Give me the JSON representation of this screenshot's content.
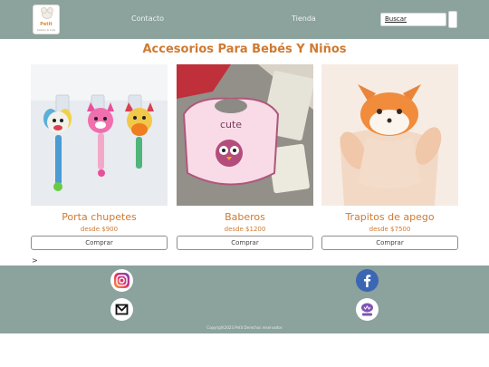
{
  "header": {
    "logo_text": "Petit",
    "logo_subtext": "babies & kids",
    "nav": [
      {
        "label": "Contacto"
      },
      {
        "label": "Tienda"
      }
    ],
    "search": {
      "value": "Buscar"
    }
  },
  "main": {
    "title": "Accesorios Para Bebés Y Niños",
    "products": [
      {
        "name": "Porta chupetes",
        "price": "desde $900",
        "button": "Comprar",
        "image": "plush-pacifier-holders"
      },
      {
        "name": "Baberos",
        "price": "desde $1200",
        "button": "Comprar",
        "image": "owl-bibs"
      },
      {
        "name": "Trapitos de apego",
        "price": "desde $7500",
        "button": "Comprar",
        "image": "fox-comforter"
      }
    ],
    "chevron": ">"
  },
  "footer": {
    "social": [
      {
        "icon": "instagram-icon"
      },
      {
        "icon": "facebook-icon"
      },
      {
        "icon": "mail-icon"
      },
      {
        "icon": "woocommerce-icon"
      }
    ],
    "copyright": "Copyright2023 Petit Derechos reservados"
  },
  "colors": {
    "bar": "#8ba29d",
    "accent": "#cf7a32"
  }
}
